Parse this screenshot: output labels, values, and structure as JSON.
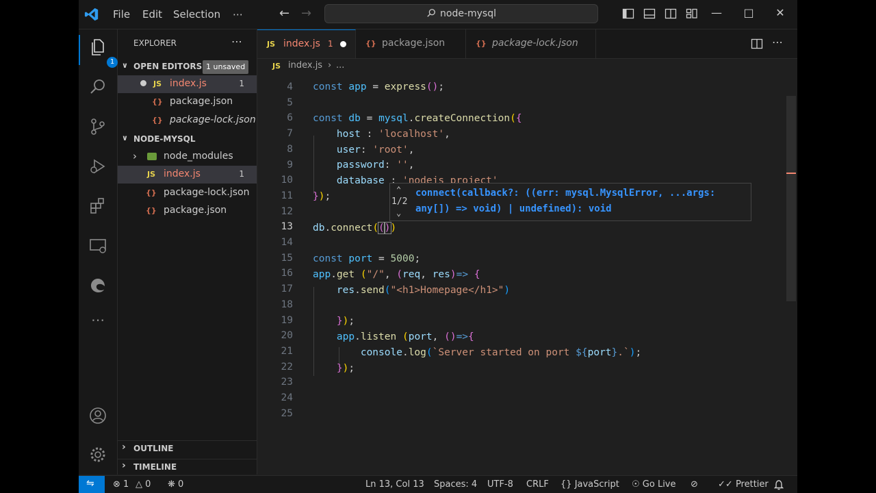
{
  "titlebar": {
    "menu": [
      "File",
      "Edit",
      "Selection",
      "⋯"
    ],
    "search_text": "node-mysql"
  },
  "activity": {
    "explorer_badge": "1"
  },
  "sidebar": {
    "title": "EXPLORER",
    "more": "⋯",
    "open_editors": {
      "label": "OPEN EDITORS",
      "unsaved": "1 unsaved",
      "items": [
        {
          "icon": "JS",
          "name": "index.js",
          "count": "1"
        },
        {
          "icon": "{}",
          "name": "package.json"
        },
        {
          "icon": "{}",
          "name": "package-lock.json"
        }
      ]
    },
    "project": {
      "label": "NODE-MYSQL",
      "items": [
        {
          "name": "node_modules"
        },
        {
          "icon": "JS",
          "name": "index.js",
          "count": "1"
        },
        {
          "icon": "{}",
          "name": "package-lock.json"
        },
        {
          "icon": "{}",
          "name": "package.json"
        }
      ]
    },
    "outline": "OUTLINE",
    "timeline": "TIMELINE"
  },
  "tabs": [
    {
      "icon": "JS",
      "name": "index.js",
      "count": "1"
    },
    {
      "icon": "{}",
      "name": "package.json"
    },
    {
      "icon": "{}",
      "name": "package-lock.json"
    }
  ],
  "breadcrumb": {
    "icon": "JS",
    "file": "index.js",
    "sep": "›",
    "rest": "..."
  },
  "editor": {
    "line_numbers": [
      "4",
      "5",
      "6",
      "7",
      "8",
      "9",
      "10",
      "11",
      "12",
      "13",
      "14",
      "15",
      "16",
      "17",
      "18",
      "19",
      "20",
      "21",
      "22",
      "23",
      "24",
      "25"
    ],
    "current_line": "13"
  },
  "hover": {
    "counter": "1/2",
    "sig_line1": "connect(callback?: ((err: mysql.MysqlError, ...args:",
    "sig_line2": "any[]) => void) | undefined): void"
  },
  "status": {
    "errors": "1",
    "warnings": "0",
    "ports": "0",
    "position": "Ln 13, Col 13",
    "spaces": "Spaces: 4",
    "encoding": "UTF-8",
    "eol": "CRLF",
    "language": "JavaScript",
    "golive": "Go Live",
    "prettier": "Prettier"
  }
}
